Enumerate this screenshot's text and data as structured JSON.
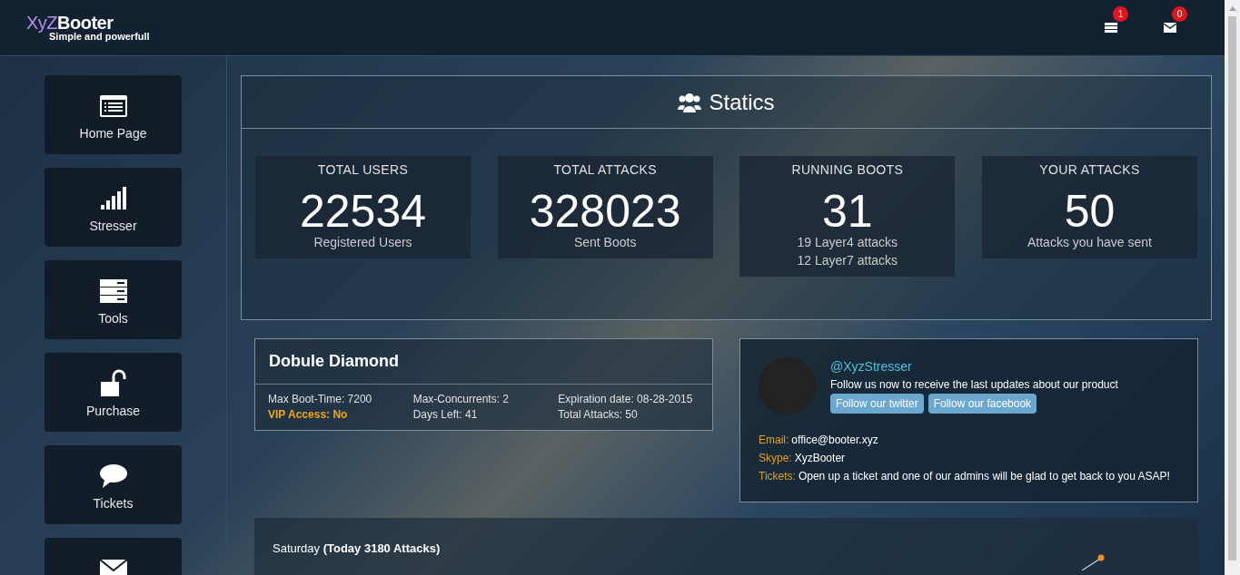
{
  "logo": {
    "name_prefix": "XyZ",
    "name_suffix": "Booter",
    "tagline": "Simple and powerfull"
  },
  "header_icons": [
    {
      "kind": "list",
      "badge": "1"
    },
    {
      "kind": "mail",
      "badge": "0"
    }
  ],
  "sidebar": {
    "items": [
      {
        "kind": "home",
        "label": "Home Page"
      },
      {
        "kind": "signal",
        "label": "Stresser"
      },
      {
        "kind": "tools",
        "label": "Tools"
      },
      {
        "kind": "lock",
        "label": "Purchase"
      },
      {
        "kind": "chat",
        "label": "Tickets"
      },
      {
        "kind": "mail"
      }
    ]
  },
  "statics": {
    "title": "Statics",
    "cards": [
      {
        "title": "TOTAL USERS",
        "value": "22534",
        "lines": [
          "Registered Users"
        ]
      },
      {
        "title": "TOTAL ATTACKS",
        "value": "328023",
        "lines": [
          "Sent Boots"
        ]
      },
      {
        "title": "RUNNING BOOTS",
        "value": "31",
        "lines": [
          "19 Layer4 attacks",
          "12 Layer7 attacks"
        ]
      },
      {
        "title": "YOUR ATTACKS",
        "value": "50",
        "lines": [
          "Attacks you have sent"
        ]
      }
    ]
  },
  "plan": {
    "title": "Dobule Diamond",
    "rows": [
      [
        "Max Boot-Time: 7200",
        "Max-Concurrents: 2",
        "Expiration date: 08-28-2015"
      ],
      [
        "VIP Access: No",
        "Days Left: 41",
        "Total Attacks: 50"
      ]
    ]
  },
  "social": {
    "handle": "@XyzStresser",
    "text": "Follow us now to receive the last updates about our product",
    "buttons": [
      "Follow our twitter",
      "Follow our facebook"
    ],
    "contacts": [
      {
        "label": "Email:",
        "value": "office@booter.xyz"
      },
      {
        "label": "Skype:",
        "value": "XyzBooter"
      },
      {
        "label": "Tickets:",
        "value": "Open up a ticket and one of our admins will be glad to get back to you ASAP!"
      }
    ]
  },
  "daily": {
    "title": "Saturday **(Today 3180 Attacks)**"
  }
}
